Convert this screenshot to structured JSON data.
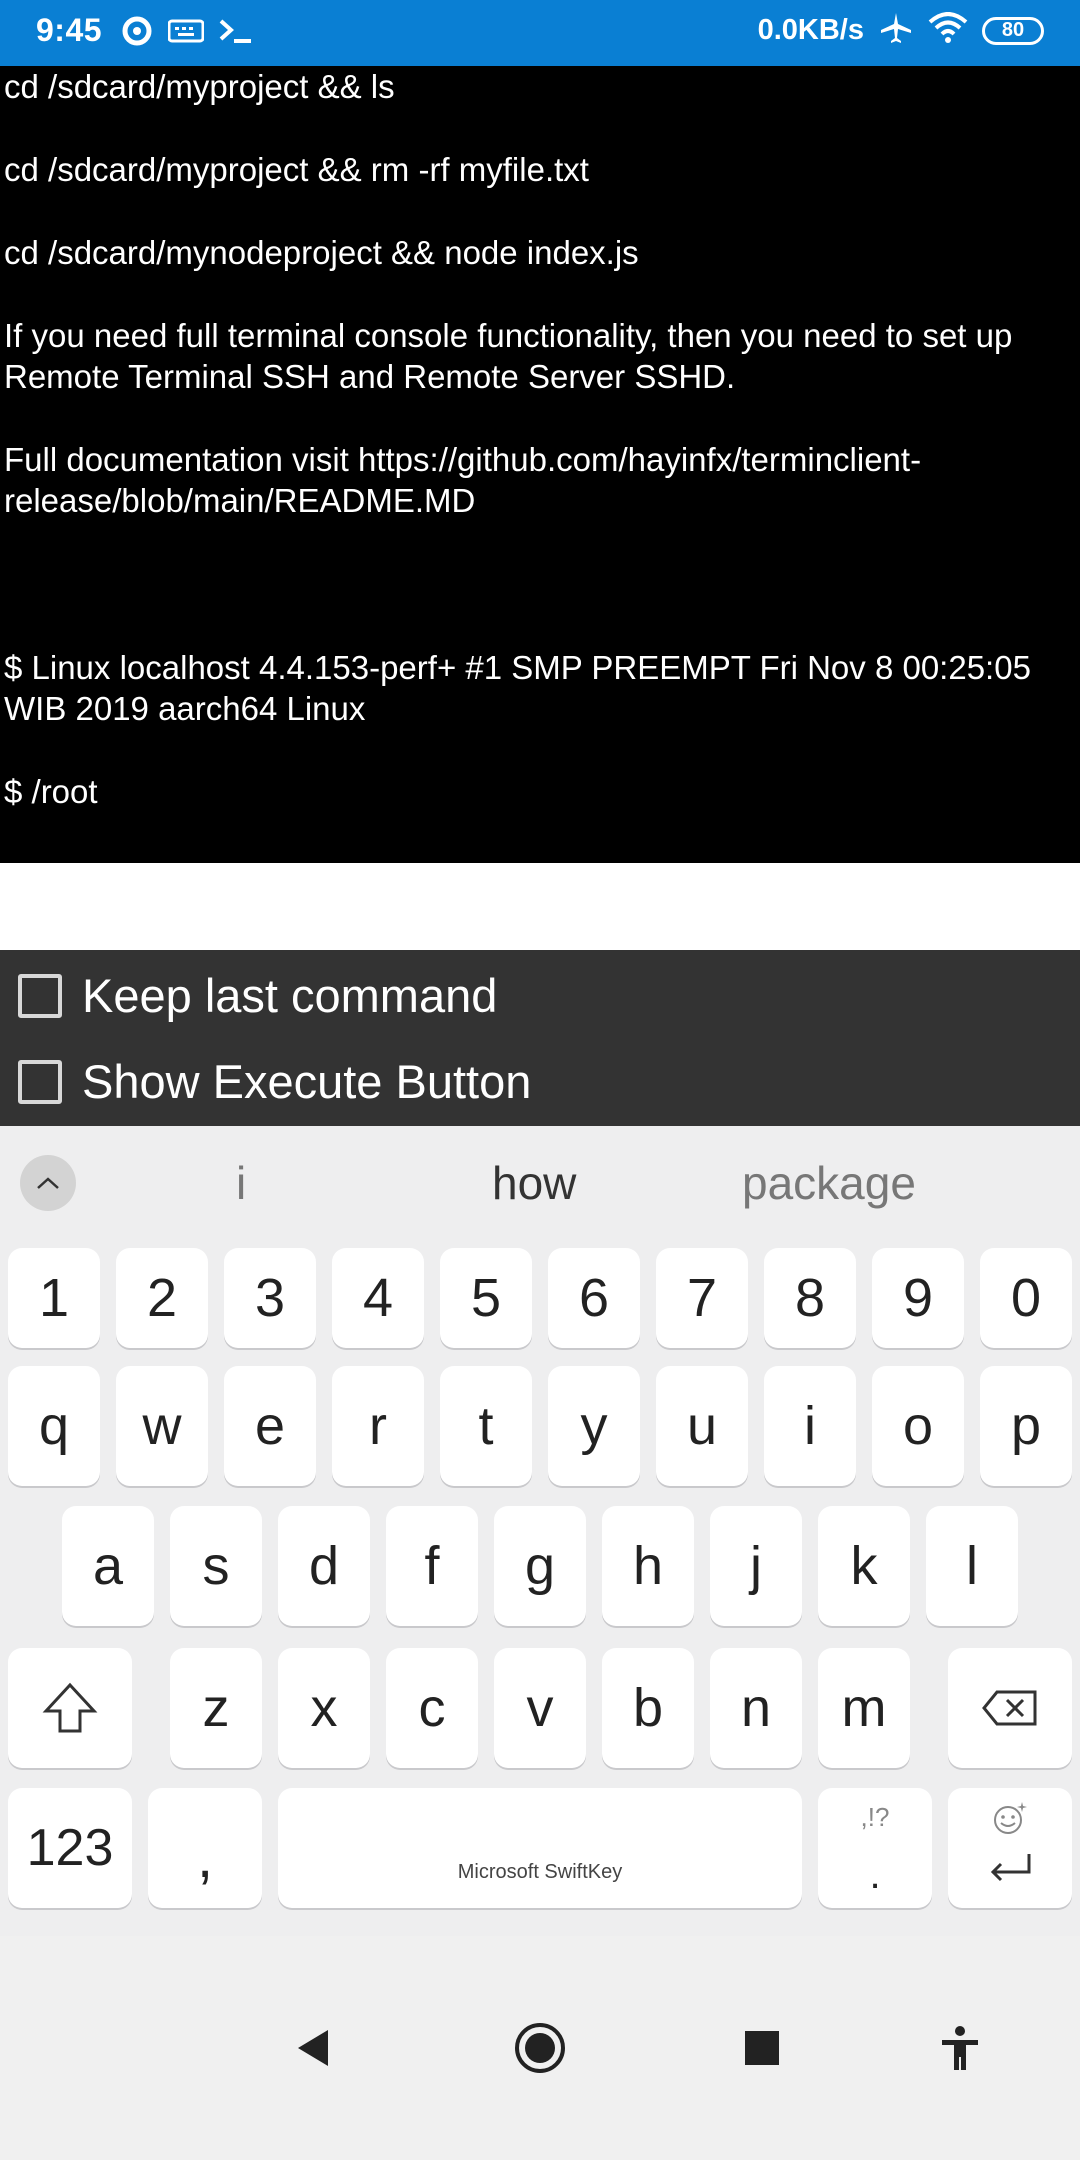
{
  "status_bar": {
    "time": "9:45",
    "network_speed": "0.0KB/s",
    "battery": "80",
    "icons": [
      "sync-icon",
      "keyboard-icon",
      "terminal-icon",
      "airplane-icon",
      "wifi-icon",
      "battery-icon"
    ]
  },
  "terminal": {
    "lines": [
      "cd /sdcard/myproject && ls",
      "",
      "cd /sdcard/myproject && rm -rf myfile.txt",
      "",
      "cd /sdcard/mynodeproject && node index.js",
      "",
      "If you need full terminal console functionality, then you need to set up Remote Terminal SSH and Remote Server SSHD.",
      "",
      "Full documentation visit https://github.com/hayinfx/terminclient-release/blob/main/README.MD",
      "",
      "",
      "",
      "$ Linux localhost 4.4.153-perf+ #1 SMP PREEMPT Fri Nov 8 00:25:05 WIB 2019 aarch64 Linux",
      "",
      "$ /root"
    ]
  },
  "options": {
    "keep_last_command": {
      "label": "Keep last command",
      "checked": false
    },
    "show_execute_button": {
      "label": "Show Execute Button",
      "checked": false
    }
  },
  "keyboard": {
    "suggestions": [
      "i",
      "how",
      "package"
    ],
    "row_numbers": [
      "1",
      "2",
      "3",
      "4",
      "5",
      "6",
      "7",
      "8",
      "9",
      "0"
    ],
    "row_top": [
      "q",
      "w",
      "e",
      "r",
      "t",
      "y",
      "u",
      "i",
      "o",
      "p"
    ],
    "row_home": [
      "a",
      "s",
      "d",
      "f",
      "g",
      "h",
      "j",
      "k",
      "l"
    ],
    "row_bottom": [
      "z",
      "x",
      "c",
      "v",
      "b",
      "n",
      "m"
    ],
    "symbols_key": "123",
    "comma_key": ",",
    "space_brand": "Microsoft SwiftKey",
    "period_hint": ",!?",
    "period_key": "."
  },
  "colors": {
    "status_bar": "#0a7fd3",
    "terminal_bg": "#000000",
    "options_bg": "#333333",
    "keyboard_bg": "#eeeeef"
  }
}
